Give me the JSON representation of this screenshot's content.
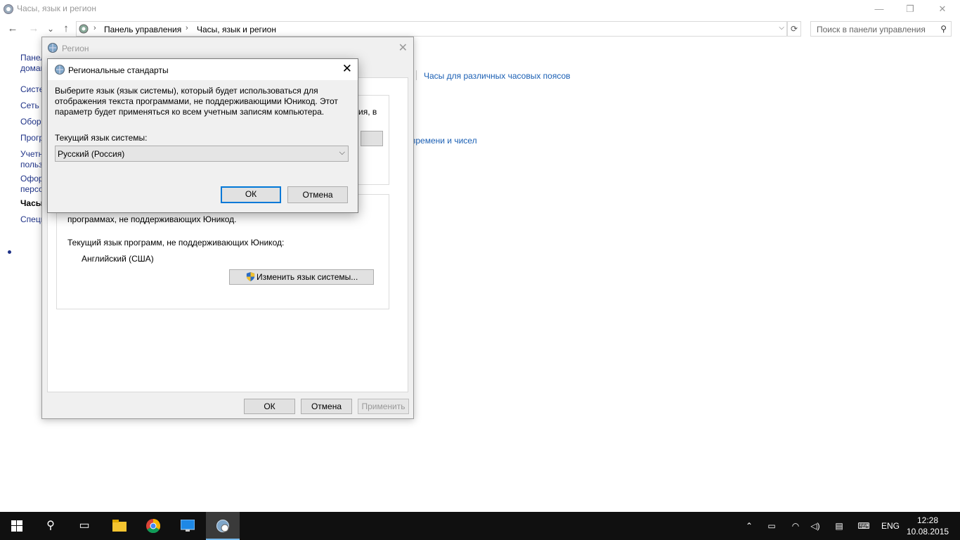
{
  "window": {
    "title": "Часы, язык и регион",
    "controls": {
      "minimize": "—",
      "restore": "❐",
      "close": "✕"
    }
  },
  "nav": {
    "back": "←",
    "forward": "→",
    "history": "⌄",
    "up": "↑",
    "breadcrumbs": [
      "Панель управления",
      "Часы, язык и регион"
    ],
    "search_placeholder": "Поиск в панели управления"
  },
  "leftnav": {
    "items": [
      {
        "label": "Панел"
      },
      {
        "label": "домаш"
      },
      {
        "label": "Систе"
      },
      {
        "label": "Сеть и"
      },
      {
        "label": "Обор"
      },
      {
        "label": "Прогр"
      },
      {
        "label": "Учетн"
      },
      {
        "label": "польз"
      },
      {
        "label": "Офор"
      },
      {
        "label": "персо"
      },
      {
        "label": "Часы"
      },
      {
        "label": "Специ"
      }
    ]
  },
  "main": {
    "link_timezones": "Часы для различных часовых поясов",
    "link_formats": "времени и чисел"
  },
  "region_dialog": {
    "title": "Регион",
    "partial_text_1": "ия, в",
    "group2_text": "программах, не поддерживающих Юникод.",
    "current_lang_label": "Текущий язык программ, не поддерживающих Юникод:",
    "current_lang_value": "Английский (США)",
    "change_button": "Изменить язык системы...",
    "ok": "ОК",
    "cancel": "Отмена",
    "apply": "Применить"
  },
  "std_dialog": {
    "title": "Региональные стандарты",
    "description": "Выберите язык (язык системы), который будет использоваться для отображения текста программами, не поддерживающими Юникод. Этот параметр будет применяться ко всем учетным записям компьютера.",
    "current_label": "Текущий язык системы:",
    "selected": "Русский (Россия)",
    "ok": "ОК",
    "cancel": "Отмена"
  },
  "taskbar": {
    "language": "ENG",
    "time": "12:28",
    "date": "10.08.2015"
  }
}
